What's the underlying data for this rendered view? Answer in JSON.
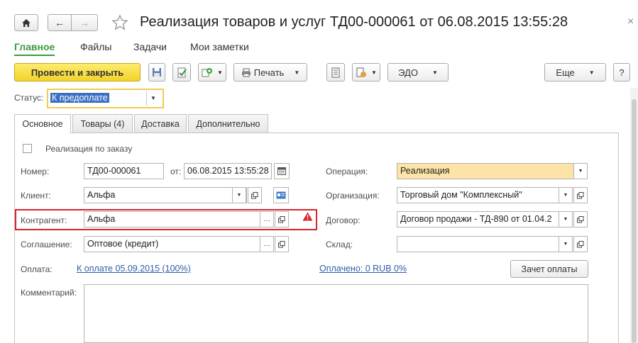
{
  "window": {
    "title": "Реализация товаров и услуг ТД00-000061 от 06.08.2015 13:55:28",
    "close": "×"
  },
  "nav_tabs": [
    "Главное",
    "Файлы",
    "Задачи",
    "Мои заметки"
  ],
  "toolbar": {
    "post_close": "Провести и закрыть",
    "print": "Печать",
    "edo": "ЭДО",
    "more": "Еще",
    "help": "?"
  },
  "status": {
    "label": "Статус:",
    "value": "К предоплате"
  },
  "page_tabs": [
    "Основное",
    "Товары (4)",
    "Доставка",
    "Дополнительно"
  ],
  "form": {
    "by_order_label": "Реализация по заказу",
    "number_label": "Номер:",
    "number_value": "ТД00-000061",
    "date_label": "от:",
    "date_value": "06.08.2015 13:55:28",
    "client_label": "Клиент:",
    "client_value": "Альфа",
    "counterparty_label": "Контрагент:",
    "counterparty_value": "Альфа",
    "agreement_label": "Соглашение:",
    "agreement_value": "Оптовое (кредит)",
    "payment_label": "Оплата:",
    "payment_link": "К оплате 05.09.2015 (100%)",
    "paid_link": "Оплачено: 0 RUB  0%",
    "offset_button": "Зачет оплаты",
    "comment_label": "Комментарий:",
    "operation_label": "Операция:",
    "operation_value": "Реализация",
    "organization_label": "Организация:",
    "organization_value": "Торговый дом \"Комплексный\"",
    "contract_label": "Договор:",
    "contract_value": "Договор продажи - ТД-890 от 01.04.2",
    "warehouse_label": "Склад:",
    "warehouse_value": ""
  },
  "colors": {
    "accent_green": "#3d9a3d",
    "primary_button": "#f3d22a",
    "highlight_border": "#d9232d",
    "operation_bg": "#fde3a7",
    "selection": "#3a6fc4"
  }
}
